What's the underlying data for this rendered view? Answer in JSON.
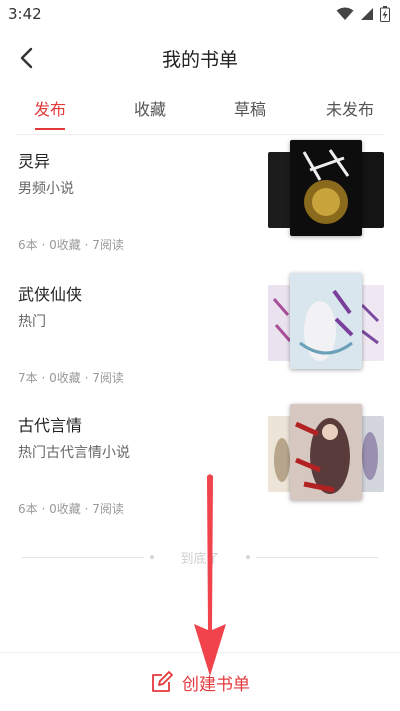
{
  "status_bar": {
    "time": "3:42"
  },
  "header": {
    "title": "我的书单"
  },
  "tabs": [
    {
      "label": "发布",
      "active": true
    },
    {
      "label": "收藏",
      "active": false
    },
    {
      "label": "草稿",
      "active": false
    },
    {
      "label": "未发布",
      "active": false
    }
  ],
  "booklists": [
    {
      "title": "灵异",
      "subtitle": "男频小说",
      "count": "6本",
      "favorites": "0收藏",
      "reads": "7阅读",
      "dot": "·",
      "covers": {
        "left": "#1c1c1c",
        "front": "#0d0d0d",
        "right": "#141414"
      }
    },
    {
      "title": "武侠仙侠",
      "subtitle": "热门",
      "count": "7本",
      "favorites": "0收藏",
      "reads": "7阅读",
      "dot": "·",
      "covers": {
        "left": "#eae3ef",
        "front": "#d9e6ee",
        "right": "#efe7f2"
      }
    },
    {
      "title": "古代言情",
      "subtitle": "热门古代言情小说",
      "count": "6本",
      "favorites": "0收藏",
      "reads": "7阅读",
      "dot": "·",
      "covers": {
        "left": "#ece4d6",
        "front": "#d6c8c0",
        "right": "#d4d6de"
      }
    }
  ],
  "end_text": "到底了",
  "bottom": {
    "create_label": "创建书单"
  },
  "colors": {
    "accent": "#e4393c",
    "annotation_arrow": "#f0434c"
  }
}
